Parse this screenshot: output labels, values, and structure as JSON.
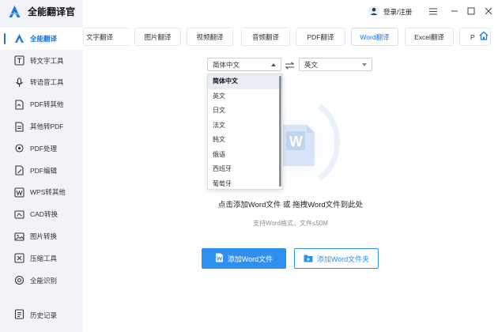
{
  "app": {
    "title": "全能翻译官",
    "accent": "#1a73e8",
    "primary_button_color": "#2f8ff0"
  },
  "header": {
    "login_label": "登录/注册"
  },
  "sidebar": {
    "items": [
      {
        "label": "全能翻译",
        "icon": "translate-logo-icon",
        "active": true
      },
      {
        "label": "转文字工具",
        "icon": "text-convert-icon"
      },
      {
        "label": "转语音工具",
        "icon": "speech-icon"
      },
      {
        "label": "PDF转其他",
        "icon": "pdf-convert-icon"
      },
      {
        "label": "其他转PDF",
        "icon": "to-pdf-icon"
      },
      {
        "label": "PDF处理",
        "icon": "pdf-process-icon"
      },
      {
        "label": "PDF编辑",
        "icon": "pdf-edit-icon"
      },
      {
        "label": "WPS转其他",
        "icon": "wps-icon"
      },
      {
        "label": "CAD转换",
        "icon": "cad-icon"
      },
      {
        "label": "图片转换",
        "icon": "image-icon"
      },
      {
        "label": "压缩工具",
        "icon": "compress-icon"
      },
      {
        "label": "全能识别",
        "icon": "recognize-icon"
      }
    ],
    "history_label": "历史记录"
  },
  "tabs": [
    "文字翻译",
    "图片翻译",
    "视频翻译",
    "音频翻译",
    "PDF翻译",
    "Word翻译",
    "Excel翻译",
    "P"
  ],
  "active_tab": "Word翻译",
  "language": {
    "source_selected": "简体中文",
    "target_selected": "英文",
    "options": [
      "简体中文",
      "英文",
      "日文",
      "法文",
      "韩文",
      "俄语",
      "西班牙",
      "葡萄牙"
    ]
  },
  "upload": {
    "file_badge": "W",
    "hint": "点击添加Word文件 或 拖拽Word文件到此处",
    "subhint": "支持Word格式，文件≤50M",
    "add_file_button": "添加Word文件",
    "add_folder_button": "添加Word文件夹"
  }
}
